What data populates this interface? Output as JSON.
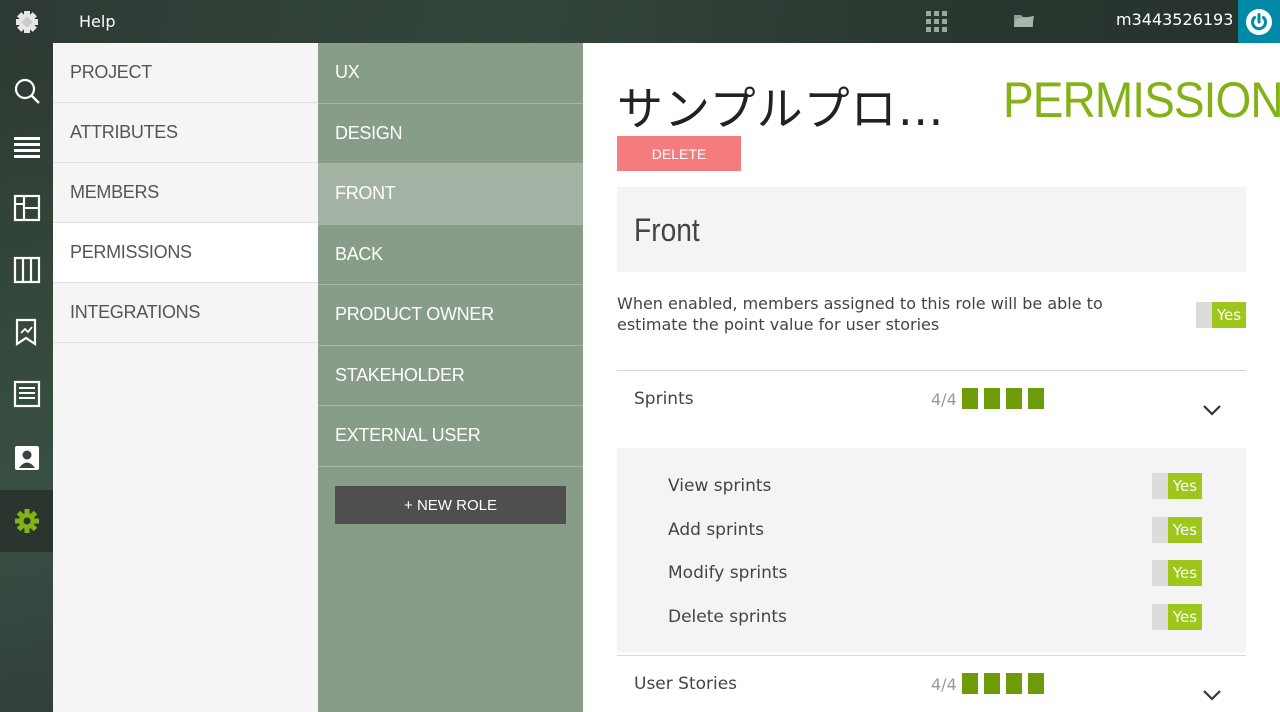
{
  "topbar": {
    "help_label": "Help",
    "username": "m3443526193",
    "icons": [
      "taiga-logo-icon",
      "apps-grid-icon",
      "projects-folder-icon",
      "power-icon"
    ]
  },
  "rail": {
    "icons": [
      "search-icon",
      "backlog-icon",
      "kanban-icon",
      "columns-icon",
      "wiki-icon",
      "issues-icon",
      "team-icon",
      "settings-gear-icon"
    ],
    "active_color": "#83b216"
  },
  "settings_nav": {
    "items": [
      {
        "label": "PROJECT"
      },
      {
        "label": "ATTRIBUTES"
      },
      {
        "label": "MEMBERS"
      },
      {
        "label": "PERMISSIONS"
      },
      {
        "label": "INTEGRATIONS"
      }
    ],
    "active": "PERMISSIONS"
  },
  "roles": {
    "items": [
      {
        "label": "UX"
      },
      {
        "label": "DESIGN"
      },
      {
        "label": "FRONT"
      },
      {
        "label": "BACK"
      },
      {
        "label": "PRODUCT OWNER"
      },
      {
        "label": "STAKEHOLDER"
      },
      {
        "label": "EXTERNAL USER"
      }
    ],
    "active": "FRONT",
    "new_role_label": "+ NEW ROLE"
  },
  "main": {
    "project_title": "サンプルプロ…",
    "section_title": "PERMISSIONS",
    "delete_label": "DELETE",
    "role_name": "Front",
    "estimate_text": "When enabled, members assigned to this role will be able to estimate the point value for user stories",
    "estimate_toggle": "Yes",
    "sections": [
      {
        "name": "Sprints",
        "count": "4/4",
        "filled": 4,
        "permissions": [
          {
            "label": "View sprints",
            "value": "Yes"
          },
          {
            "label": "Add sprints",
            "value": "Yes"
          },
          {
            "label": "Modify sprints",
            "value": "Yes"
          },
          {
            "label": "Delete sprints",
            "value": "Yes"
          }
        ]
      },
      {
        "name": "User Stories",
        "count": "4/4",
        "filled": 4
      }
    ],
    "colors": {
      "accent": "#83b216",
      "delete": "#f47c7c",
      "bars": "#6e9b0a"
    }
  }
}
